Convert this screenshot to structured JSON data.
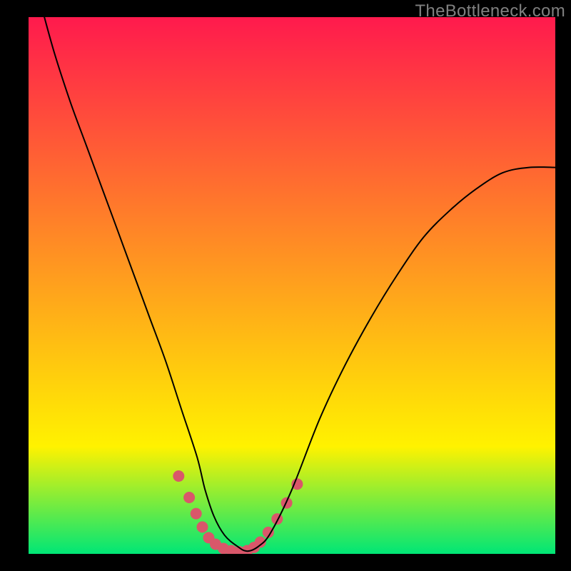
{
  "watermark": "TheBottleneck.com",
  "gradient": {
    "from": "#ff1a4d",
    "via": "#fff200",
    "to": "#00e676",
    "stops": [
      0,
      0.8,
      1.0
    ]
  },
  "chart_data": {
    "type": "line",
    "title": "",
    "xlabel": "",
    "ylabel": "",
    "xlim": [
      0,
      1
    ],
    "ylim": [
      0,
      1
    ],
    "series": [
      {
        "name": "curve",
        "x": [
          0.03,
          0.05,
          0.08,
          0.11,
          0.14,
          0.17,
          0.2,
          0.23,
          0.26,
          0.29,
          0.32,
          0.335,
          0.352,
          0.372,
          0.395,
          0.415,
          0.438,
          0.46,
          0.5,
          0.552,
          0.6,
          0.65,
          0.7,
          0.75,
          0.8,
          0.85,
          0.9,
          0.95,
          1.0
        ],
        "y": [
          1.0,
          0.93,
          0.84,
          0.76,
          0.68,
          0.6,
          0.52,
          0.44,
          0.36,
          0.27,
          0.18,
          0.12,
          0.07,
          0.035,
          0.015,
          0.005,
          0.015,
          0.04,
          0.12,
          0.25,
          0.35,
          0.44,
          0.52,
          0.59,
          0.64,
          0.68,
          0.71,
          0.72,
          0.72
        ]
      }
    ],
    "marker_cluster": {
      "points": [
        [
          0.285,
          0.145
        ],
        [
          0.305,
          0.105
        ],
        [
          0.318,
          0.075
        ],
        [
          0.33,
          0.05
        ],
        [
          0.342,
          0.03
        ],
        [
          0.355,
          0.018
        ],
        [
          0.37,
          0.01
        ],
        [
          0.385,
          0.006
        ],
        [
          0.4,
          0.004
        ],
        [
          0.415,
          0.006
        ],
        [
          0.428,
          0.012
        ],
        [
          0.44,
          0.022
        ],
        [
          0.455,
          0.04
        ],
        [
          0.472,
          0.065
        ],
        [
          0.49,
          0.095
        ],
        [
          0.51,
          0.13
        ]
      ],
      "radius": 8,
      "color": "#d9576a"
    }
  }
}
